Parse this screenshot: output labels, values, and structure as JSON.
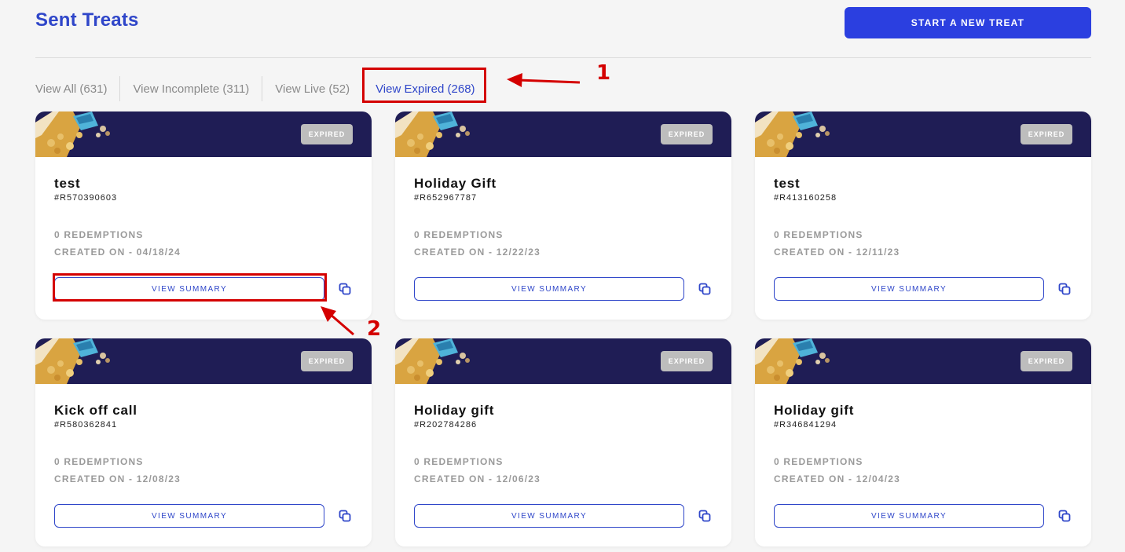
{
  "header": {
    "title": "Sent Treats",
    "new_treat_label": "START A NEW TREAT"
  },
  "tabs": [
    {
      "label": "View All (631)",
      "active": false
    },
    {
      "label": "View Incomplete (311)",
      "active": false
    },
    {
      "label": "View Live (52)",
      "active": false
    },
    {
      "label": "View Expired (268)",
      "active": true
    }
  ],
  "annotations": {
    "marker_1": "1",
    "marker_2": "2",
    "color": "#d40000"
  },
  "cards": [
    {
      "badge": "EXPIRED",
      "title": "test",
      "id": "#R570390603",
      "redemptions": "0 REDEMPTIONS",
      "created": "CREATED ON - 04/18/24",
      "summary_label": "VIEW SUMMARY"
    },
    {
      "badge": "EXPIRED",
      "title": "Holiday Gift",
      "id": "#R652967787",
      "redemptions": "0 REDEMPTIONS",
      "created": "CREATED ON - 12/22/23",
      "summary_label": "VIEW SUMMARY"
    },
    {
      "badge": "EXPIRED",
      "title": "test",
      "id": "#R413160258",
      "redemptions": "0 REDEMPTIONS",
      "created": "CREATED ON - 12/11/23",
      "summary_label": "VIEW SUMMARY"
    },
    {
      "badge": "EXPIRED",
      "title": "Kick off call",
      "id": "#R580362841",
      "redemptions": "0 REDEMPTIONS",
      "created": "CREATED ON - 12/08/23",
      "summary_label": "VIEW SUMMARY"
    },
    {
      "badge": "EXPIRED",
      "title": "Holiday gift",
      "id": "#R202784286",
      "redemptions": "0 REDEMPTIONS",
      "created": "CREATED ON - 12/06/23",
      "summary_label": "VIEW SUMMARY"
    },
    {
      "badge": "EXPIRED",
      "title": "Holiday gift",
      "id": "#R346841294",
      "redemptions": "0 REDEMPTIONS",
      "created": "CREATED ON - 12/04/23",
      "summary_label": "VIEW SUMMARY"
    }
  ],
  "icons": {
    "copy": "copy-icon",
    "banner_art": "snack-bag-illustration"
  },
  "colors": {
    "accent": "#2f46c9",
    "primary_button": "#2b3fe0",
    "banner": "#1f1d55",
    "badge": "#bdbdbd"
  }
}
